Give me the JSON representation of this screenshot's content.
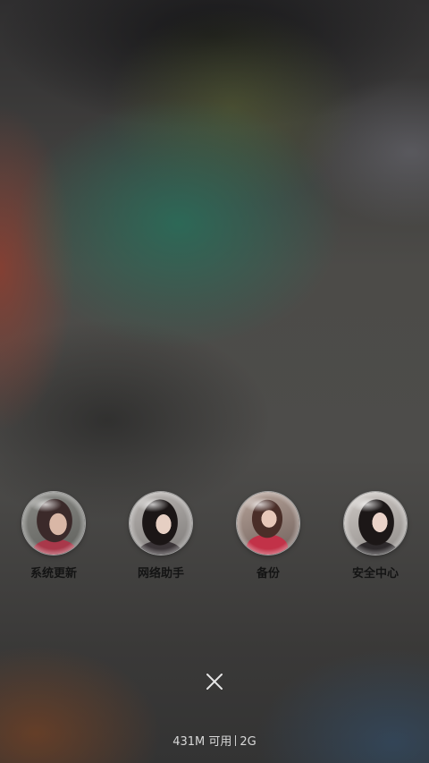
{
  "shortcuts": [
    {
      "label": "系统更新",
      "icon": "system-update-photo-icon"
    },
    {
      "label": "网络助手",
      "icon": "network-assistant-photo-icon"
    },
    {
      "label": "备份",
      "icon": "backup-photo-icon"
    },
    {
      "label": "安全中心",
      "icon": "security-center-photo-icon"
    }
  ],
  "close": {
    "icon": "close-icon"
  },
  "memory": {
    "available": "431M 可用",
    "total": "2G"
  },
  "colors": {
    "label_text": "#141414",
    "status_text": "#d8d8d8"
  }
}
